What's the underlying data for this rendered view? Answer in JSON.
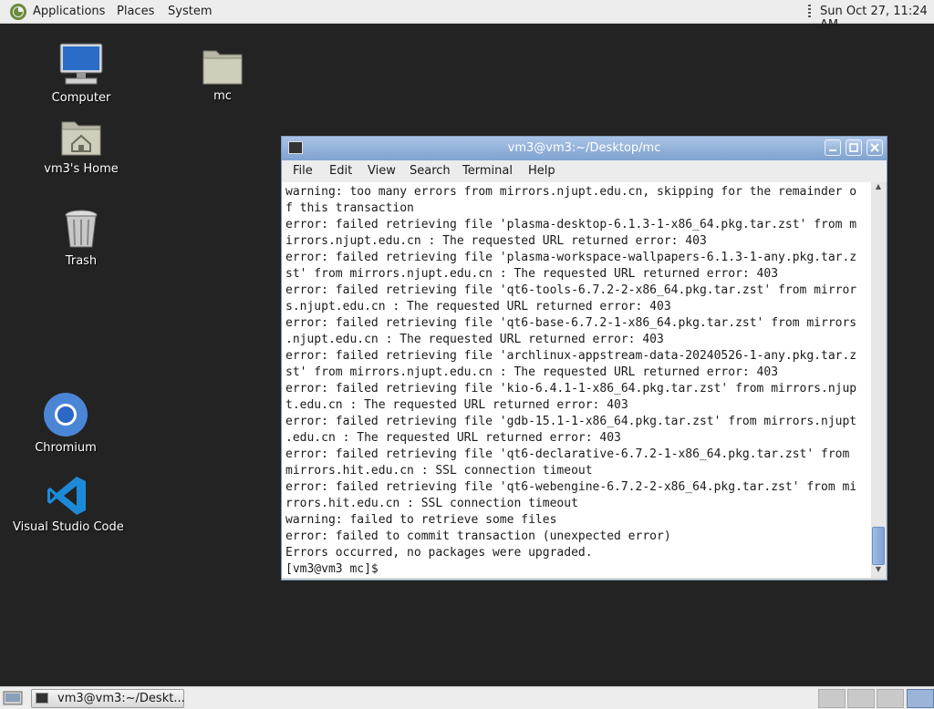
{
  "top_panel": {
    "menu": [
      "Applications",
      "Places",
      "System"
    ],
    "clock": "Sun Oct 27, 11:24 AM"
  },
  "desktop": {
    "icons": [
      {
        "label": "Computer",
        "icon": "computer-icon"
      },
      {
        "label": "mc",
        "icon": "folder-icon"
      },
      {
        "label": "vm3's Home",
        "icon": "home-folder-icon"
      },
      {
        "label": "Trash",
        "icon": "trash-icon"
      },
      {
        "label": "Chromium",
        "icon": "chromium-icon"
      },
      {
        "label": "Visual Studio Code",
        "icon": "vscode-icon"
      }
    ]
  },
  "terminal": {
    "title": "vm3@vm3:~/Desktop/mc",
    "menu": [
      "File",
      "Edit",
      "View",
      "Search",
      "Terminal",
      "Help"
    ],
    "lines": [
      "warning: too many errors from mirrors.njupt.edu.cn, skipping for the remainder o",
      "f this transaction",
      "error: failed retrieving file 'plasma-desktop-6.1.3-1-x86_64.pkg.tar.zst' from m",
      "irrors.njupt.edu.cn : The requested URL returned error: 403",
      "error: failed retrieving file 'plasma-workspace-wallpapers-6.1.3-1-any.pkg.tar.z",
      "st' from mirrors.njupt.edu.cn : The requested URL returned error: 403",
      "error: failed retrieving file 'qt6-tools-6.7.2-2-x86_64.pkg.tar.zst' from mirror",
      "s.njupt.edu.cn : The requested URL returned error: 403",
      "error: failed retrieving file 'qt6-base-6.7.2-1-x86_64.pkg.tar.zst' from mirrors",
      ".njupt.edu.cn : The requested URL returned error: 403",
      "error: failed retrieving file 'archlinux-appstream-data-20240526-1-any.pkg.tar.z",
      "st' from mirrors.njupt.edu.cn : The requested URL returned error: 403",
      "error: failed retrieving file 'kio-6.4.1-1-x86_64.pkg.tar.zst' from mirrors.njup",
      "t.edu.cn : The requested URL returned error: 403",
      "error: failed retrieving file 'gdb-15.1-1-x86_64.pkg.tar.zst' from mirrors.njupt",
      ".edu.cn : The requested URL returned error: 403",
      "error: failed retrieving file 'qt6-declarative-6.7.2-1-x86_64.pkg.tar.zst' from",
      "mirrors.hit.edu.cn : SSL connection timeout",
      "error: failed retrieving file 'qt6-webengine-6.7.2-2-x86_64.pkg.tar.zst' from mi",
      "rrors.hit.edu.cn : SSL connection timeout",
      "warning: failed to retrieve some files",
      "error: failed to commit transaction (unexpected error)",
      "Errors occurred, no packages were upgraded.",
      "[vm3@vm3 mc]$ "
    ]
  },
  "taskbar": {
    "task_label": "vm3@vm3:~/Deskt..."
  }
}
